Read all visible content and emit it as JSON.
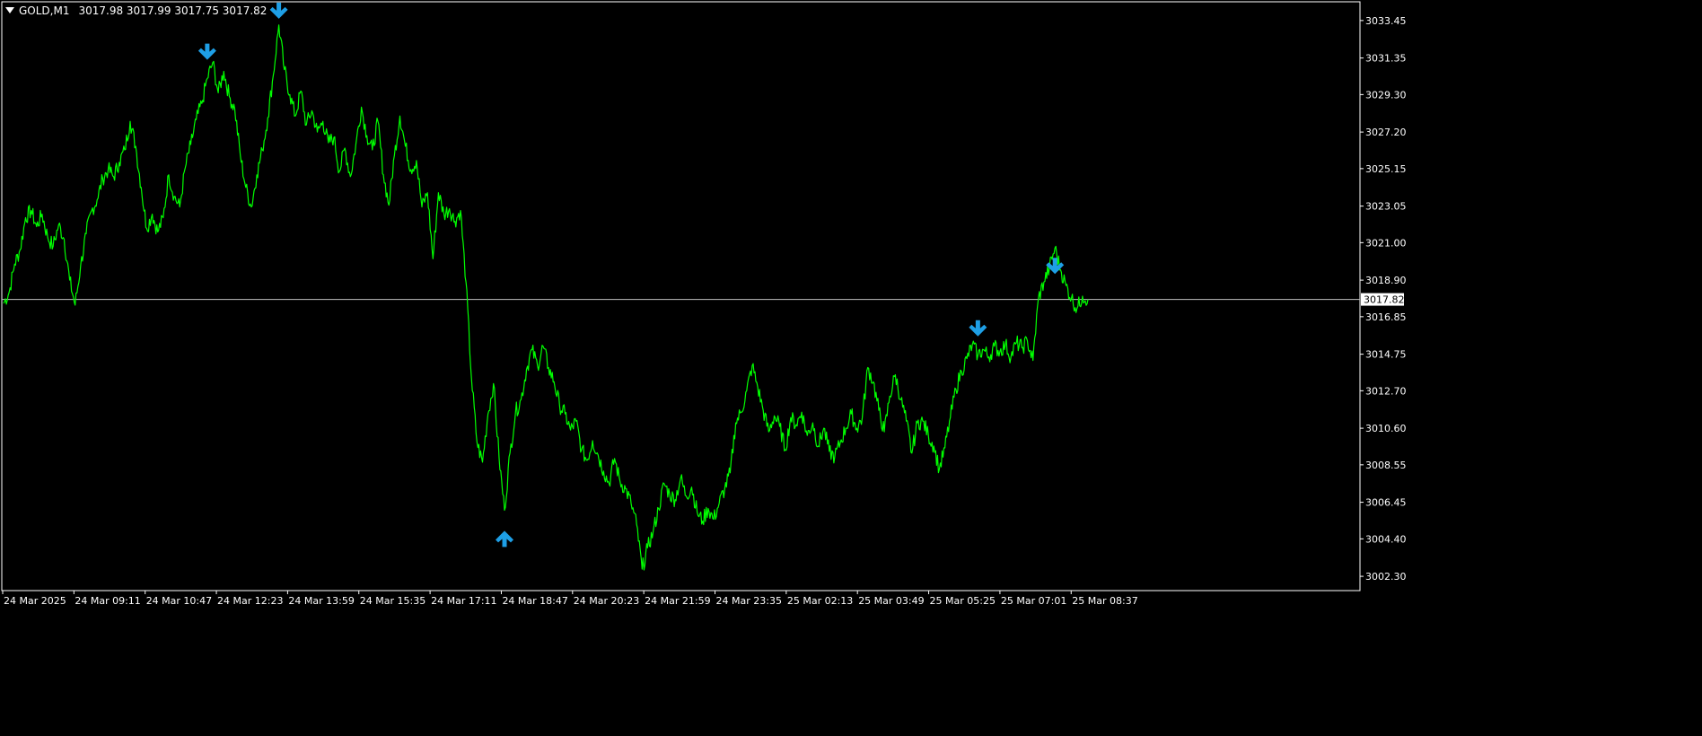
{
  "header": {
    "symbol": "GOLD,M1",
    "ohlc": "3017.98 3017.99 3017.75 3017.82"
  },
  "colors": {
    "background": "#000000",
    "price_line": "#00ff00",
    "arrow": "#1e9fe6",
    "grid_frame": "#ffffff",
    "current_price_line": "#c0c0c0"
  },
  "chart_data": {
    "type": "line",
    "title": "GOLD,M1",
    "xlabel": "",
    "ylabel": "",
    "ylim": [
      3001.5,
      3034.5
    ],
    "grid": false,
    "y_ticks": [
      "3033.45",
      "3031.35",
      "3029.30",
      "3027.20",
      "3025.15",
      "3023.05",
      "3021.00",
      "3018.90",
      "3016.85",
      "3014.75",
      "3012.70",
      "3010.60",
      "3008.55",
      "3006.45",
      "3004.40",
      "3002.30"
    ],
    "x_ticks": [
      "24 Mar 2025",
      "24 Mar 09:11",
      "24 Mar 10:47",
      "24 Mar 12:23",
      "24 Mar 13:59",
      "24 Mar 15:35",
      "24 Mar 17:11",
      "24 Mar 18:47",
      "24 Mar 20:23",
      "24 Mar 21:59",
      "24 Mar 23:35",
      "25 Mar 02:13",
      "25 Mar 03:49",
      "25 Mar 05:25",
      "25 Mar 07:01",
      "25 Mar 08:37"
    ],
    "current_price": "3017.82",
    "series": [
      {
        "points": [
          [
            0,
            3017.6
          ],
          [
            1,
            3018.2
          ],
          [
            2,
            3019.8
          ],
          [
            3,
            3020.6
          ],
          [
            4,
            3022.4
          ],
          [
            5,
            3022.8
          ],
          [
            6,
            3021.9
          ],
          [
            7,
            3022.6
          ],
          [
            8,
            3021.3
          ],
          [
            9,
            3020.8
          ],
          [
            10,
            3022.0
          ],
          [
            11,
            3021.2
          ],
          [
            12,
            3018.9
          ],
          [
            13,
            3017.5
          ],
          [
            14,
            3019.7
          ],
          [
            15,
            3021.5
          ],
          [
            16,
            3022.8
          ],
          [
            17,
            3023.4
          ],
          [
            18,
            3024.6
          ],
          [
            19,
            3025.1
          ],
          [
            20,
            3024.7
          ],
          [
            21,
            3025.5
          ],
          [
            22,
            3026.2
          ],
          [
            23,
            3027.8
          ],
          [
            24,
            3026.4
          ],
          [
            25,
            3024.1
          ],
          [
            26,
            3021.8
          ],
          [
            27,
            3022.6
          ],
          [
            28,
            3021.6
          ],
          [
            29,
            3022.4
          ],
          [
            30,
            3024.8
          ],
          [
            31,
            3023.6
          ],
          [
            32,
            3023.0
          ],
          [
            33,
            3025.2
          ],
          [
            34,
            3026.5
          ],
          [
            35,
            3027.9
          ],
          [
            36,
            3028.8
          ],
          [
            37,
            3030.2
          ],
          [
            38,
            3031.1
          ],
          [
            39,
            3029.4
          ],
          [
            40,
            3030.6
          ],
          [
            41,
            3029.2
          ],
          [
            42,
            3028.5
          ],
          [
            43,
            3025.9
          ],
          [
            44,
            3024.1
          ],
          [
            45,
            3023.0
          ],
          [
            46,
            3024.8
          ],
          [
            47,
            3026.2
          ],
          [
            48,
            3028.0
          ],
          [
            49,
            3030.4
          ],
          [
            50,
            3033.2
          ],
          [
            51,
            3030.7
          ],
          [
            52,
            3029.3
          ],
          [
            53,
            3028.1
          ],
          [
            54,
            3029.5
          ],
          [
            55,
            3027.6
          ],
          [
            56,
            3028.4
          ],
          [
            57,
            3027.2
          ],
          [
            58,
            3027.8
          ],
          [
            59,
            3026.6
          ],
          [
            60,
            3026.9
          ],
          [
            61,
            3025.0
          ],
          [
            62,
            3026.3
          ],
          [
            63,
            3024.7
          ],
          [
            64,
            3026.5
          ],
          [
            65,
            3028.6
          ],
          [
            66,
            3027.0
          ],
          [
            67,
            3026.2
          ],
          [
            68,
            3027.8
          ],
          [
            69,
            3024.8
          ],
          [
            70,
            3023.1
          ],
          [
            71,
            3025.9
          ],
          [
            72,
            3028.1
          ],
          [
            73,
            3026.4
          ],
          [
            74,
            3025.1
          ],
          [
            75,
            3025.6
          ],
          [
            76,
            3023.0
          ],
          [
            77,
            3023.8
          ],
          [
            78,
            3020.1
          ],
          [
            79,
            3023.8
          ],
          [
            80,
            3022.6
          ],
          [
            81,
            3022.9
          ],
          [
            82,
            3022.2
          ],
          [
            83,
            3022.8
          ],
          [
            84,
            3018.8
          ],
          [
            85,
            3013.4
          ],
          [
            86,
            3009.8
          ],
          [
            87,
            3008.7
          ],
          [
            88,
            3011.4
          ],
          [
            89,
            3013.1
          ],
          [
            90,
            3009.0
          ],
          [
            91,
            3006.0
          ],
          [
            92,
            3009.2
          ],
          [
            93,
            3011.5
          ],
          [
            94,
            3012.2
          ],
          [
            95,
            3013.9
          ],
          [
            96,
            3015.0
          ],
          [
            97,
            3014.1
          ],
          [
            98,
            3015.2
          ],
          [
            99,
            3014.0
          ],
          [
            100,
            3013.2
          ],
          [
            101,
            3011.9
          ],
          [
            102,
            3011.4
          ],
          [
            103,
            3010.5
          ],
          [
            104,
            3011.0
          ],
          [
            105,
            3009.4
          ],
          [
            106,
            3008.8
          ],
          [
            107,
            3009.9
          ],
          [
            108,
            3009.1
          ],
          [
            109,
            3008.2
          ],
          [
            110,
            3007.5
          ],
          [
            111,
            3008.9
          ],
          [
            112,
            3007.6
          ],
          [
            113,
            3007.2
          ],
          [
            114,
            3006.4
          ],
          [
            115,
            3005.2
          ],
          [
            116,
            3002.7
          ],
          [
            117,
            3003.9
          ],
          [
            118,
            3004.8
          ],
          [
            119,
            3006.1
          ],
          [
            120,
            3007.5
          ],
          [
            121,
            3006.9
          ],
          [
            122,
            3006.6
          ],
          [
            123,
            3007.8
          ],
          [
            124,
            3006.8
          ],
          [
            125,
            3007.3
          ],
          [
            126,
            3005.9
          ],
          [
            127,
            3005.4
          ],
          [
            128,
            3006.1
          ],
          [
            129,
            3005.5
          ],
          [
            130,
            3006.4
          ],
          [
            131,
            3007.2
          ],
          [
            132,
            3008.1
          ],
          [
            133,
            3010.9
          ],
          [
            134,
            3011.5
          ],
          [
            135,
            3012.7
          ],
          [
            136,
            3014.1
          ],
          [
            137,
            3012.9
          ],
          [
            138,
            3011.6
          ],
          [
            139,
            3010.4
          ],
          [
            140,
            3011.3
          ],
          [
            141,
            3010.7
          ],
          [
            142,
            3009.4
          ],
          [
            143,
            3011.2
          ],
          [
            144,
            3010.8
          ],
          [
            145,
            3011.5
          ],
          [
            146,
            3010.2
          ],
          [
            147,
            3010.9
          ],
          [
            148,
            3009.6
          ],
          [
            149,
            3010.6
          ],
          [
            150,
            3009.3
          ],
          [
            151,
            3009.0
          ],
          [
            152,
            3009.8
          ],
          [
            153,
            3010.6
          ],
          [
            154,
            3011.4
          ],
          [
            155,
            3010.6
          ],
          [
            156,
            3011.2
          ],
          [
            157,
            3014.0
          ],
          [
            158,
            3013.2
          ],
          [
            159,
            3011.6
          ],
          [
            160,
            3010.4
          ],
          [
            161,
            3012.4
          ],
          [
            162,
            3013.6
          ],
          [
            163,
            3012.2
          ],
          [
            164,
            3011.0
          ],
          [
            165,
            3009.2
          ],
          [
            166,
            3010.9
          ],
          [
            167,
            3011.0
          ],
          [
            168,
            3010.2
          ],
          [
            169,
            3009.6
          ],
          [
            170,
            3008.3
          ],
          [
            171,
            3009.5
          ],
          [
            172,
            3011.2
          ],
          [
            173,
            3012.8
          ],
          [
            174,
            3013.8
          ],
          [
            175,
            3014.5
          ],
          [
            176,
            3015.3
          ],
          [
            177,
            3014.7
          ],
          [
            178,
            3015.0
          ],
          [
            179,
            3014.6
          ],
          [
            180,
            3015.2
          ],
          [
            181,
            3014.9
          ],
          [
            182,
            3015.3
          ],
          [
            183,
            3014.6
          ],
          [
            184,
            3015.4
          ],
          [
            185,
            3015.1
          ],
          [
            186,
            3015.5
          ],
          [
            187,
            3014.4
          ],
          [
            188,
            3017.9
          ],
          [
            189,
            3018.8
          ],
          [
            190,
            3019.6
          ],
          [
            191,
            3020.7
          ],
          [
            192,
            3019.5
          ],
          [
            193,
            3018.6
          ],
          [
            194,
            3017.9
          ],
          [
            195,
            3017.3
          ],
          [
            196,
            3018.0
          ],
          [
            197,
            3017.82
          ]
        ]
      }
    ],
    "signals": [
      {
        "type": "sell",
        "at": [
          37,
          3031.6
        ]
      },
      {
        "type": "sell",
        "at": [
          50,
          3033.9
        ]
      },
      {
        "type": "buy",
        "at": [
          91,
          3004.5
        ]
      },
      {
        "type": "sell",
        "at": [
          177,
          3016.1
        ]
      },
      {
        "type": "sell",
        "at": [
          191,
          3019.6
        ]
      }
    ]
  }
}
